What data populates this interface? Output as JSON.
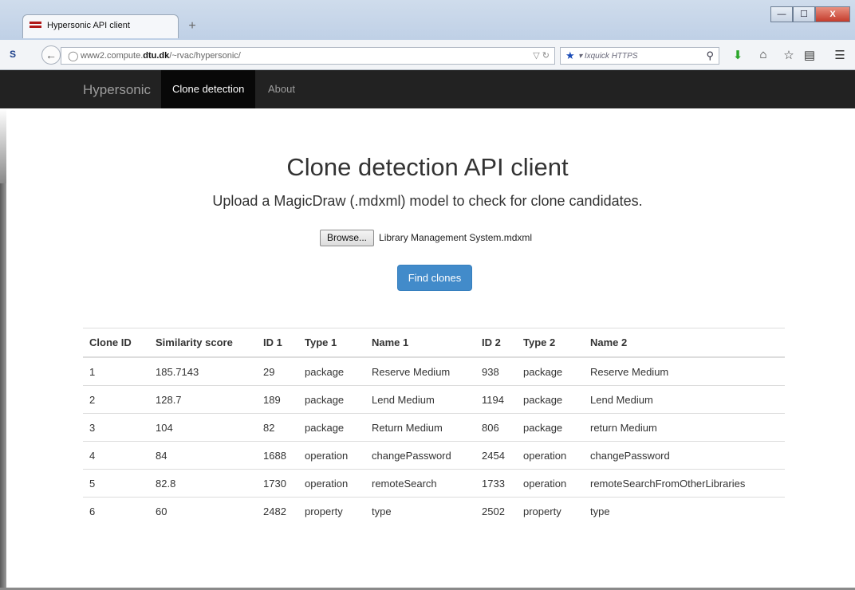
{
  "browser": {
    "tab_title": "Hypersonic API client",
    "new_tab_symbol": "+",
    "url_prefix": "www2.compute.",
    "url_domain": "dtu.dk",
    "url_path": "/~rvac/hypersonic/",
    "search_engine": "Ixquick HTTPS",
    "window_buttons": [
      "—",
      "☐",
      "X"
    ]
  },
  "nav": {
    "brand": "Hypersonic",
    "items": [
      "Clone detection",
      "About"
    ],
    "active": "Clone detection"
  },
  "main": {
    "title": "Clone detection API client",
    "subtitle": "Upload a MagicDraw (.mdxml) model to check for clone candidates.",
    "browse_label": "Browse...",
    "file_name": "Library Management System.mdxml",
    "submit_label": "Find clones"
  },
  "table": {
    "headers": [
      "Clone ID",
      "Similarity score",
      "ID 1",
      "Type 1",
      "Name 1",
      "ID 2",
      "Type 2",
      "Name 2"
    ],
    "rows": [
      [
        "1",
        "185.7143",
        "29",
        "package",
        "Reserve Medium",
        "938",
        "package",
        "Reserve Medium"
      ],
      [
        "2",
        "128.7",
        "189",
        "package",
        "Lend Medium",
        "1194",
        "package",
        "Lend Medium"
      ],
      [
        "3",
        "104",
        "82",
        "package",
        "Return Medium",
        "806",
        "package",
        "return Medium"
      ],
      [
        "4",
        "84",
        "1688",
        "operation",
        "changePassword",
        "2454",
        "operation",
        "changePassword"
      ],
      [
        "5",
        "82.8",
        "1730",
        "operation",
        "remoteSearch",
        "1733",
        "operation",
        "remoteSearchFromOtherLibraries"
      ],
      [
        "6",
        "60",
        "2482",
        "property",
        "type",
        "2502",
        "property",
        "type"
      ]
    ]
  },
  "colors": {
    "navbar_bg": "#222222",
    "active_nav_bg": "#080808",
    "primary_button": "#428bca"
  }
}
